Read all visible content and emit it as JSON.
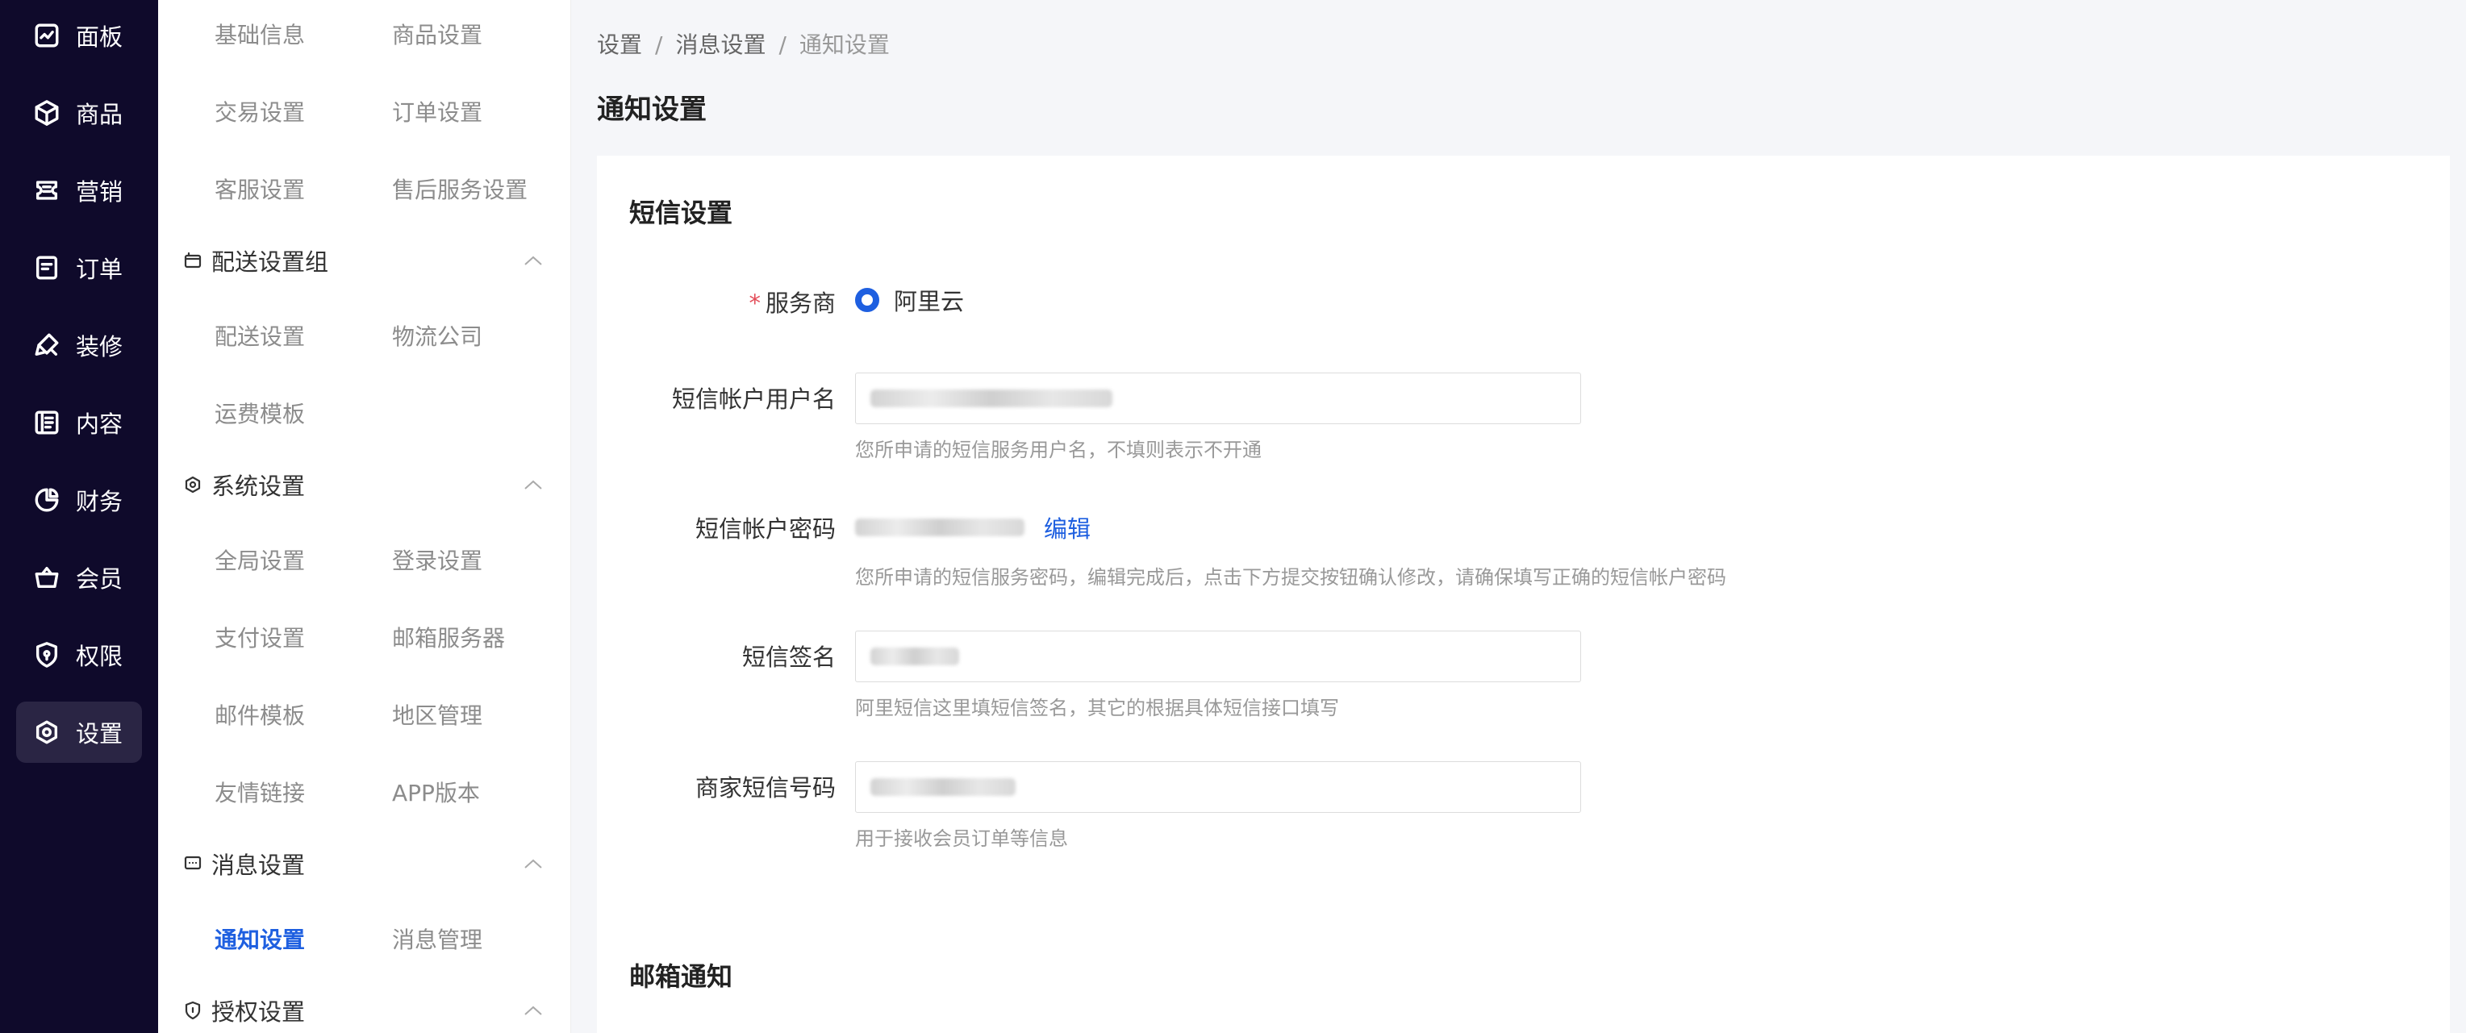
{
  "nav": {
    "items": [
      {
        "label": "面板",
        "icon": "dashboard-icon"
      },
      {
        "label": "商品",
        "icon": "cube-icon"
      },
      {
        "label": "营销",
        "icon": "ticket-icon"
      },
      {
        "label": "订单",
        "icon": "order-icon"
      },
      {
        "label": "装修",
        "icon": "paint-icon"
      },
      {
        "label": "内容",
        "icon": "content-icon"
      },
      {
        "label": "财务",
        "icon": "pie-chart-icon"
      },
      {
        "label": "会员",
        "icon": "basket-icon"
      },
      {
        "label": "权限",
        "icon": "shield-icon"
      },
      {
        "label": "设置",
        "icon": "settings-icon"
      }
    ],
    "active": "设置"
  },
  "submenu": {
    "top_links": [
      "基础信息",
      "商品设置",
      "交易设置",
      "订单设置",
      "客服设置",
      "售后服务设置"
    ],
    "groups": [
      {
        "title": "配送设置组",
        "icon": "truck-icon",
        "links": [
          "配送设置",
          "物流公司",
          "运费模板"
        ]
      },
      {
        "title": "系统设置",
        "icon": "gear-icon",
        "links": [
          "全局设置",
          "登录设置",
          "支付设置",
          "邮箱服务器",
          "邮件模板",
          "地区管理",
          "友情链接",
          "APP版本"
        ]
      },
      {
        "title": "消息设置",
        "icon": "message-icon",
        "links": [
          "通知设置",
          "消息管理"
        ]
      },
      {
        "title": "授权设置",
        "icon": "shield-check-icon",
        "links": []
      }
    ],
    "active_link": "通知设置"
  },
  "breadcrumb": [
    "设置",
    "消息设置",
    "通知设置"
  ],
  "breadcrumb_sep": "/",
  "page_title": "通知设置",
  "sms": {
    "title": "短信设置",
    "provider": {
      "required_mark": "*",
      "label": "服务商",
      "option": "阿里云"
    },
    "username": {
      "label": "短信帐户用户名",
      "help": "您所申请的短信服务用户名，不填则表示不开通"
    },
    "password": {
      "label": "短信帐户密码",
      "edit": "编辑",
      "help": "您所申请的短信服务密码，编辑完成后，点击下方提交按钮确认修改，请确保填写正确的短信帐户密码"
    },
    "signature": {
      "label": "短信签名",
      "help": "阿里短信这里填短信签名，其它的根据具体短信接口填写"
    },
    "merchant_phone": {
      "label": "商家短信号码",
      "help": "用于接收会员订单等信息"
    }
  },
  "email": {
    "title": "邮箱通知"
  },
  "colors": {
    "nav_bg": "#0f0a2b",
    "accent": "#1e5fe0",
    "required": "#e34d59"
  }
}
